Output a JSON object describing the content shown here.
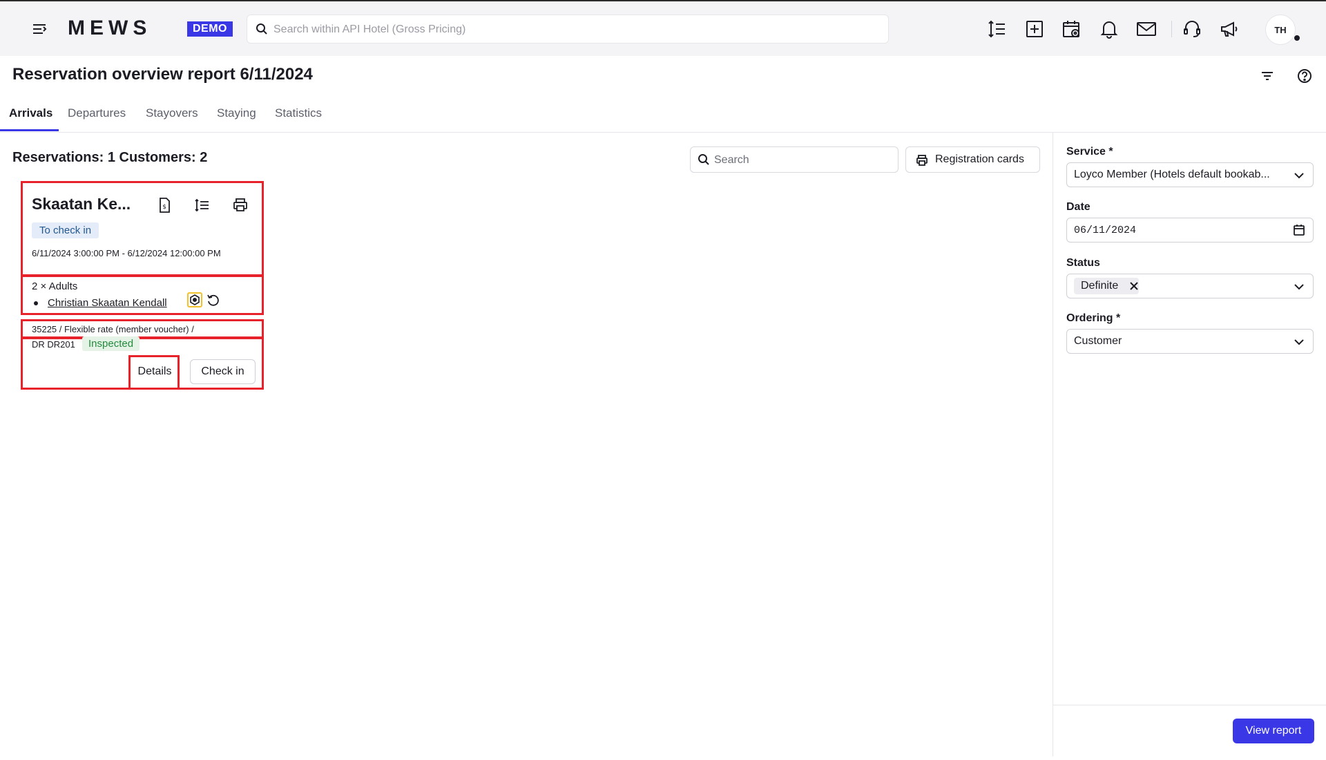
{
  "topbar": {
    "logo": "MEWS",
    "demo_badge": "DEMO",
    "search_placeholder": "Search within API Hotel (Gross Pricing)",
    "icons": [
      "menu-icon",
      "sort-lines-icon",
      "add-box-icon",
      "calendar-view-icon",
      "bell-icon",
      "mail-icon",
      "support-headset-icon",
      "megaphone-icon"
    ],
    "avatar_initials": "TH"
  },
  "header": {
    "title": "Reservation overview report 6/11/2024",
    "icons": [
      "filter-icon",
      "help-icon"
    ]
  },
  "tabs": [
    {
      "label": "Arrivals",
      "active": true
    },
    {
      "label": "Departures",
      "active": false
    },
    {
      "label": "Stayovers",
      "active": false
    },
    {
      "label": "Staying",
      "active": false
    },
    {
      "label": "Statistics",
      "active": false
    }
  ],
  "main": {
    "summary": "Reservations: 1 Customers: 2",
    "search_placeholder": "Search",
    "registration_cards_label": "Registration cards"
  },
  "reservation": {
    "name": "Skaatan Ke...",
    "status": "To check in",
    "dates": "6/11/2024 3:00:00 PM - 6/12/2024 12:00:00 PM",
    "adults": "2 × Adults",
    "guest": "Christian Skaatan Kendall",
    "rate_line": "35225 / Flexible rate (member voucher) /",
    "room": "DR DR201",
    "room_status": "Inspected",
    "details_label": "Details",
    "checkin_label": "Check in"
  },
  "filters": {
    "service_label": "Service *",
    "service_value": "Loyco Member (Hotels default bookab...",
    "date_label": "Date",
    "date_value": "06/11/2024",
    "status_label": "Status",
    "status_chip": "Definite",
    "ordering_label": "Ordering *",
    "ordering_value": "Customer",
    "view_report_label": "View report"
  },
  "colors": {
    "accent": "#3a37e6",
    "highlight": "#e8222a",
    "status_tag_bg": "#e3ecf8",
    "inspected_bg": "#e5f3e7",
    "inspected_text": "#238a3c",
    "loyalty_highlight": "#f2c12e"
  }
}
